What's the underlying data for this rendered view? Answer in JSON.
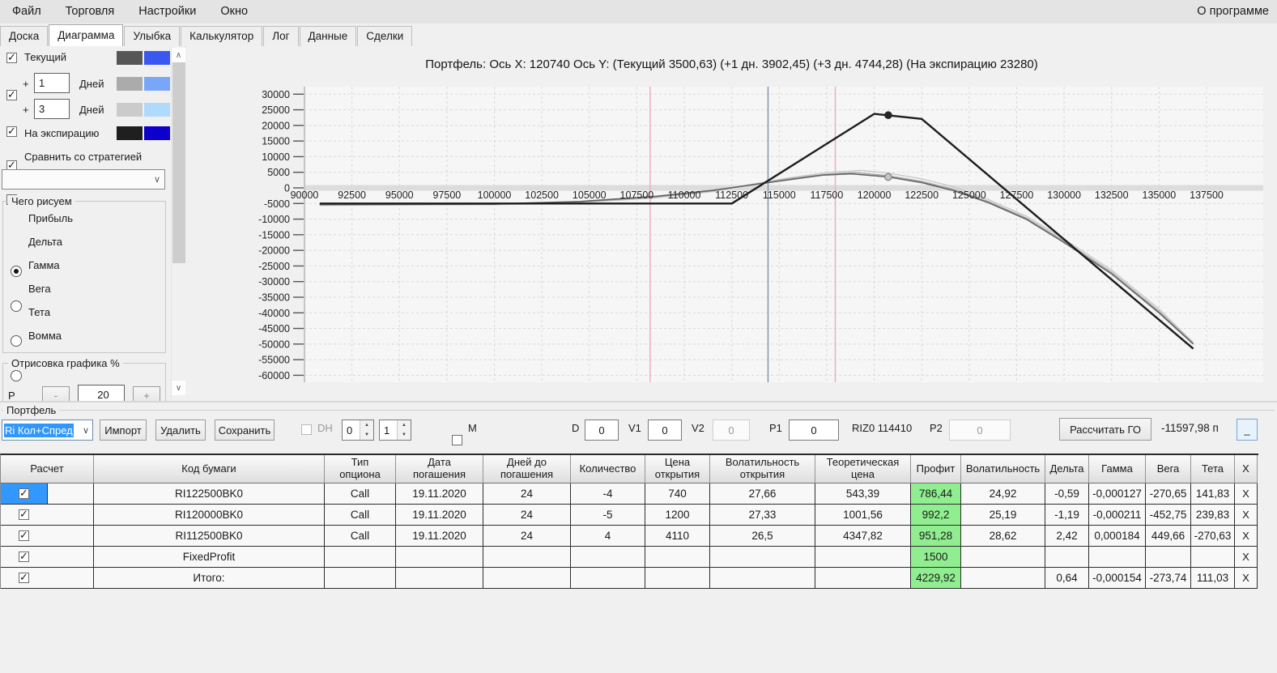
{
  "menu": {
    "items": [
      "Файл",
      "Торговля",
      "Настройки",
      "Окно"
    ],
    "about": "О программе"
  },
  "tabs": [
    {
      "label": "Доска"
    },
    {
      "label": "Диаграмма"
    },
    {
      "label": "Улыбка"
    },
    {
      "label": "Калькулятор"
    },
    {
      "label": "Лог"
    },
    {
      "label": "Данные"
    },
    {
      "label": "Сделки"
    }
  ],
  "sidebar": {
    "layers": [
      {
        "label": "Текущий",
        "swatch1": "#565656",
        "swatch2": "#3a57f0"
      },
      {
        "prefix": "+",
        "value": "1",
        "suffix": "Дней",
        "swatch1": "#ababab",
        "swatch2": "#7aa6f8"
      },
      {
        "prefix": "+",
        "value": "3",
        "suffix": "Дней",
        "swatch1": "#cbcbcb",
        "swatch2": "#aedafc"
      },
      {
        "label": "На экспирацию",
        "swatch1": "#1f1f1f",
        "swatch2": "#0d00cc"
      }
    ],
    "compare_label": "Сравнить со стратегией",
    "draw_group": {
      "title": "Чего рисуем",
      "options": [
        "Прибыль",
        "Дельта",
        "Гамма",
        "Вега",
        "Тета",
        "Вомма"
      ],
      "selected": 0
    },
    "render_group": {
      "title": "Отрисовка графика %",
      "row_label": "Р",
      "minus": "-",
      "value": "20",
      "plus": "+"
    }
  },
  "chart_data": {
    "type": "line",
    "title": "Портфель: Ось X: 120740 Ось Y:  (Текущий 3500,63)  (+1 дн. 3902,45)  (+3 дн. 4744,28)  (На экспирацию 23280)",
    "cursor_x": 120740,
    "x_ticks": [
      90000,
      92500,
      95000,
      97500,
      100000,
      102500,
      105000,
      107500,
      110000,
      112500,
      115000,
      117500,
      120000,
      122500,
      125000,
      127500,
      130000,
      132500,
      135000,
      137500
    ],
    "y_ticks": [
      30000,
      25000,
      20000,
      15000,
      10000,
      5000,
      0,
      -5000,
      -10000,
      -15000,
      -20000,
      -25000,
      -30000,
      -35000,
      -40000,
      -45000,
      -50000,
      -55000,
      -60000
    ],
    "xlim": [
      90000,
      137500
    ],
    "ylim": [
      -60000,
      30000
    ],
    "grid": true,
    "vertical_markers": [
      {
        "name": "lower-bound",
        "x": 108200,
        "color": "#efaebc"
      },
      {
        "name": "futures-price",
        "x": 114410,
        "color": "#8696ab"
      },
      {
        "name": "upper-bound",
        "x": 117950,
        "color": "#efaebc"
      }
    ],
    "series": [
      {
        "name": "plus3days",
        "color": "#c9c9c9",
        "width": 1.4,
        "points": [
          [
            90800,
            -5600
          ],
          [
            100000,
            -5400
          ],
          [
            104500,
            -4700
          ],
          [
            108500,
            -3200
          ],
          [
            111500,
            -1200
          ],
          [
            113500,
            1100
          ],
          [
            115500,
            3200
          ],
          [
            117500,
            4900
          ],
          [
            119300,
            5600
          ],
          [
            120740,
            4744
          ],
          [
            122500,
            2900
          ],
          [
            124200,
            300
          ],
          [
            126000,
            -3700
          ],
          [
            128000,
            -9000
          ],
          [
            130000,
            -16400
          ],
          [
            132500,
            -26300
          ],
          [
            135000,
            -38800
          ],
          [
            136800,
            -49500
          ]
        ]
      },
      {
        "name": "plus1day",
        "color": "#a9a9a9",
        "width": 1.4,
        "points": [
          [
            90800,
            -5450
          ],
          [
            100000,
            -5250
          ],
          [
            104500,
            -4500
          ],
          [
            108500,
            -2900
          ],
          [
            111500,
            -900
          ],
          [
            113500,
            1000
          ],
          [
            115500,
            2900
          ],
          [
            117500,
            4400
          ],
          [
            119000,
            4900
          ],
          [
            120740,
            3902
          ],
          [
            122500,
            2100
          ],
          [
            124200,
            -500
          ],
          [
            126000,
            -4300
          ],
          [
            128000,
            -9600
          ],
          [
            130000,
            -17000
          ],
          [
            132500,
            -27000
          ],
          [
            135000,
            -39500
          ],
          [
            136800,
            -49800
          ]
        ]
      },
      {
        "name": "current",
        "color": "#636363",
        "width": 1.6,
        "points": [
          [
            90800,
            -5350
          ],
          [
            100000,
            -5150
          ],
          [
            104500,
            -4350
          ],
          [
            108500,
            -2700
          ],
          [
            111500,
            -800
          ],
          [
            113500,
            900
          ],
          [
            115500,
            2600
          ],
          [
            117300,
            4100
          ],
          [
            118800,
            4500
          ],
          [
            120740,
            3500
          ],
          [
            122500,
            1700
          ],
          [
            124200,
            -900
          ],
          [
            126000,
            -4700
          ],
          [
            128000,
            -10000
          ],
          [
            130000,
            -17500
          ],
          [
            132500,
            -27500
          ],
          [
            135000,
            -40000
          ],
          [
            136800,
            -50000
          ]
        ]
      },
      {
        "name": "expiration",
        "color": "#1c1c1c",
        "width": 2.4,
        "points": [
          [
            90800,
            -5000
          ],
          [
            112500,
            -5000
          ],
          [
            120000,
            23700
          ],
          [
            122500,
            22100
          ],
          [
            136800,
            -51500
          ]
        ]
      }
    ],
    "cursor_points": [
      {
        "series": "expiration",
        "x": 120740,
        "y": 23280,
        "fill": "#262626",
        "stroke": "#262626"
      },
      {
        "series": "current",
        "x": 120740,
        "y": 3500,
        "fill": "#c4c4c4",
        "stroke": "#7e7e7e"
      }
    ]
  },
  "portfolio": {
    "group_label": "Портфель",
    "combo_value": "Ri Кол+Спред",
    "import_label": "Импорт",
    "delete_label": "Удалить",
    "save_label": "Сохранить",
    "dh_label": "DH",
    "spinner1": "0",
    "spinner2": "1",
    "m_label": "M",
    "d_label": "D",
    "d_value": "0",
    "v1_label": "V1",
    "v1_value": "0",
    "v2_label": "V2",
    "v2_value": "0",
    "p1_label": "P1",
    "p1_value": "0",
    "riz0_label": "RIZ0 114410",
    "p2_label": "P2",
    "p2_value": "0",
    "calc_label": "Рассчитать ГО",
    "go_value": "-11597,98 п",
    "minimize_label": "_"
  },
  "table": {
    "columns": [
      "Расчет",
      "Код бумаги",
      "Тип\nопциона",
      "Дата\nпогашения",
      "Дней до\nпогашения",
      "Количество",
      "Цена\nоткрытия",
      "Волатильность\nоткрытия",
      "Теоретическая\nцена",
      "Профит",
      "Волатильность",
      "Дельта",
      "Гамма",
      "Вега",
      "Тета",
      "X"
    ],
    "delete_label": "X",
    "profit_color": "#90ee90",
    "selection_color": "#3298fd",
    "rows": [
      {
        "checked": true,
        "selected": true,
        "cells": [
          "RI122500BK0",
          "Call",
          "19.11.2020",
          "24",
          "-4",
          "740",
          "27,66",
          "543,39",
          "786,44",
          "24,92",
          "-0,59",
          "-0,000127",
          "-270,65",
          "141,83"
        ]
      },
      {
        "checked": true,
        "selected": false,
        "cells": [
          "RI120000BK0",
          "Call",
          "19.11.2020",
          "24",
          "-5",
          "1200",
          "27,33",
          "1001,56",
          "992,2",
          "25,19",
          "-1,19",
          "-0,000211",
          "-452,75",
          "239,83"
        ]
      },
      {
        "checked": true,
        "selected": false,
        "cells": [
          "RI112500BK0",
          "Call",
          "19.11.2020",
          "24",
          "4",
          "4110",
          "26,5",
          "4347,82",
          "951,28",
          "28,62",
          "2,42",
          "0,000184",
          "449,66",
          "-270,63"
        ]
      },
      {
        "checked": true,
        "selected": false,
        "cells": [
          "FixedProfit",
          "",
          "",
          "",
          "",
          "",
          "",
          "",
          "1500",
          "",
          "",
          "",
          "",
          ""
        ]
      },
      {
        "checked": true,
        "selected": false,
        "cells": [
          "Итого:",
          "",
          "",
          "",
          "",
          "",
          "",
          "",
          "4229,92",
          "",
          "0,64",
          "-0,000154",
          "-273,74",
          "111,03"
        ]
      }
    ]
  }
}
